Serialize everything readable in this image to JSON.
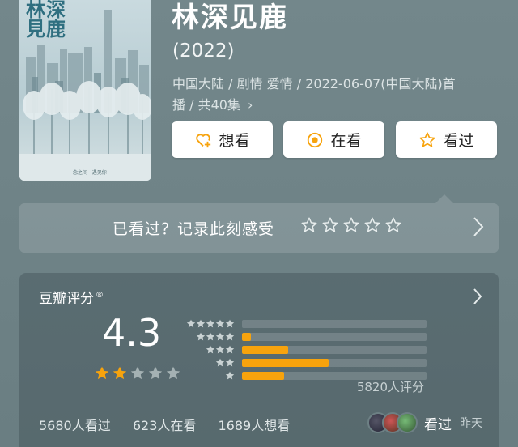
{
  "poster": {
    "title_chars": "林深見鹿",
    "caption": "一念之间 · 遇见你"
  },
  "movie": {
    "title": "林深见鹿",
    "year": "(2022)",
    "meta_line1": "中国大陆 / 剧情 爱情 / 2022-06-07(中国大陆)首",
    "meta_line2": "播 / 共40集",
    "meta_chevron": "›"
  },
  "actions": {
    "want_label": "想看",
    "watching_label": "在看",
    "watched_label": "看过"
  },
  "record": {
    "prompt": "已看过？记录此刻感受",
    "star_count": 5
  },
  "rating": {
    "source_label": "豆瓣评分",
    "registered_mark": "®",
    "score": "4.3",
    "score_stars_filled": 2,
    "distribution": [
      {
        "stars": 5,
        "fraction": 0.0
      },
      {
        "stars": 4,
        "fraction": 0.05
      },
      {
        "stars": 3,
        "fraction": 0.25
      },
      {
        "stars": 2,
        "fraction": 0.47
      },
      {
        "stars": 1,
        "fraction": 0.23
      }
    ],
    "total_ratings": "5820人评分",
    "watched_count": "5680人看过",
    "watching_count": "623人在看",
    "want_count": "1689人想看",
    "friend_action": "看过",
    "friend_time": "昨天"
  },
  "colors": {
    "accent": "#f7a30d",
    "background": "#73878b"
  }
}
